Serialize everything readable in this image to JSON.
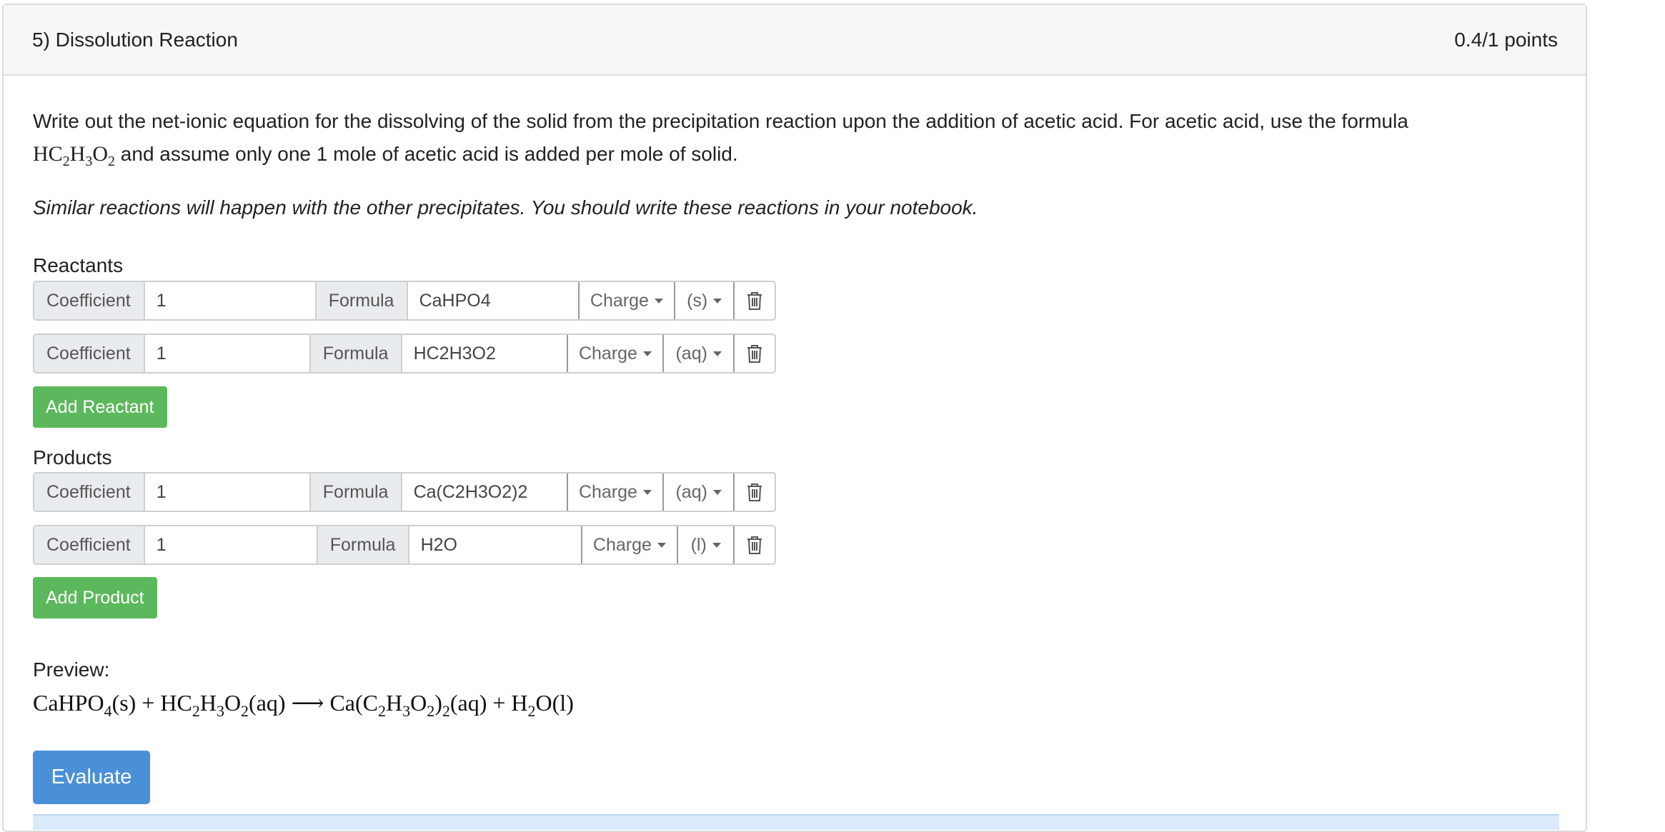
{
  "header": {
    "title": "5) Dissolution Reaction",
    "score": "0.4/1 points"
  },
  "instructions": {
    "line1": "Write out the net-ionic equation for the dissolving of the solid from the precipitation reaction upon the addition of acetic acid.  For acetic acid, use the formula",
    "line2_suffix": " and assume only one 1 mole of acetic acid is added per mole of solid.",
    "note": "Similar reactions will happen with the other precipitates.  You should write these reactions in your notebook."
  },
  "labels": {
    "coefficient": "Coefficient",
    "formula": "Formula",
    "charge": "Charge"
  },
  "reactants": {
    "label": "Reactants",
    "rows": [
      {
        "coefficient": "1",
        "formula": "CaHPO4",
        "state": "(s)"
      },
      {
        "coefficient": "1",
        "formula": "HC2H3O2",
        "state": "(aq)"
      }
    ],
    "add_label": "Add Reactant"
  },
  "products": {
    "label": "Products",
    "rows": [
      {
        "coefficient": "1",
        "formula": "Ca(C2H3O2)2",
        "state": "(aq)"
      },
      {
        "coefficient": "1",
        "formula": "H2O",
        "state": "(l)"
      }
    ],
    "add_label": "Add Product"
  },
  "preview": {
    "label": "Preview:"
  },
  "evaluate_label": "Evaluate",
  "icons": {
    "delete": "trash-icon",
    "dropdown": "caret-down-icon"
  },
  "colors": {
    "green": "#5cb85c",
    "blue": "#4a90d9"
  }
}
